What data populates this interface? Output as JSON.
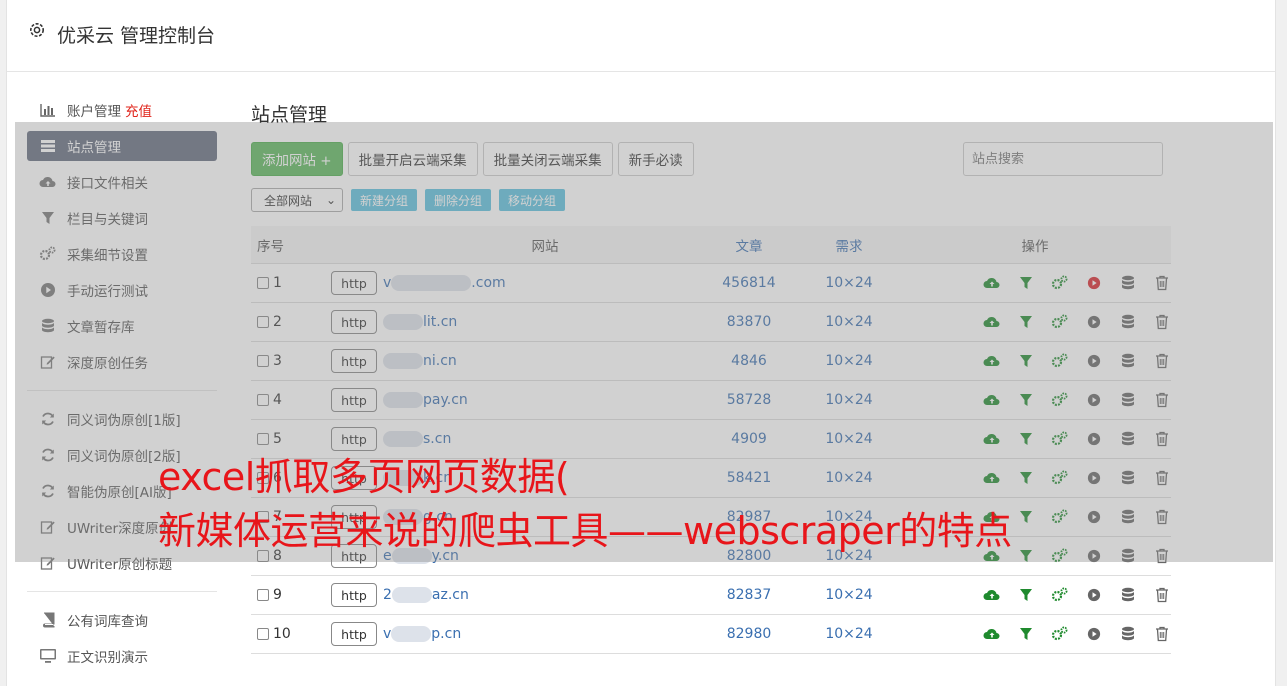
{
  "header": {
    "title": "优采云 管理控制台"
  },
  "sidebar": {
    "items": [
      {
        "label": "账户管理",
        "badge": "充值",
        "icon": "bar-chart-icon"
      },
      {
        "label": "站点管理",
        "icon": "server-icon",
        "active": true
      },
      {
        "label": "接口文件相关",
        "icon": "cloud-upload-icon"
      },
      {
        "label": "栏目与关键词",
        "icon": "filter-icon"
      },
      {
        "label": "采集细节设置",
        "icon": "gears-icon"
      },
      {
        "label": "手动运行测试",
        "icon": "play-circle-icon"
      },
      {
        "label": "文章暂存库",
        "icon": "database-icon"
      },
      {
        "label": "深度原创任务",
        "icon": "edit-icon"
      }
    ],
    "items2": [
      {
        "label": "同义词伪原创[1版]",
        "icon": "refresh-icon"
      },
      {
        "label": "同义词伪原创[2版]",
        "icon": "refresh-icon"
      },
      {
        "label": "智能伪原创[AI版]",
        "icon": "refresh-icon"
      },
      {
        "label": "UWriter深度原创",
        "icon": "edit-icon"
      },
      {
        "label": "UWriter原创标题",
        "icon": "edit-icon"
      }
    ],
    "items3": [
      {
        "label": "公有词库查询",
        "icon": "book-icon"
      },
      {
        "label": "正文识别演示",
        "icon": "monitor-icon"
      }
    ]
  },
  "main": {
    "title": "站点管理",
    "toolbar": {
      "add": "添加网站 +",
      "batch_open": "批量开启云端采集",
      "batch_close": "批量关闭云端采集",
      "guide": "新手必读"
    },
    "search_placeholder": "站点搜索",
    "group_select": "全部网站",
    "group_buttons": {
      "new": "新建分组",
      "delete": "删除分组",
      "move": "移动分组"
    },
    "columns": {
      "no": "序号",
      "site": "网站",
      "articles": "文章",
      "demand": "需求",
      "ops": "操作"
    },
    "rows": [
      {
        "no": "1",
        "prefix": "v",
        "domain": ".com",
        "articles": "456814",
        "demand": "10×24",
        "running": true
      },
      {
        "no": "2",
        "prefix": "",
        "domain": "lit.cn",
        "articles": "83870",
        "demand": "10×24",
        "running": false
      },
      {
        "no": "3",
        "prefix": "",
        "domain": "ni.cn",
        "articles": "4846",
        "demand": "10×24",
        "running": false
      },
      {
        "no": "4",
        "prefix": "",
        "domain": "pay.cn",
        "articles": "58728",
        "demand": "10×24",
        "running": false
      },
      {
        "no": "5",
        "prefix": "",
        "domain": "s.cn",
        "articles": "4909",
        "demand": "10×24",
        "running": false
      },
      {
        "no": "6",
        "prefix": "",
        "domain": "k.cn",
        "articles": "58421",
        "demand": "10×24",
        "running": false
      },
      {
        "no": "7",
        "prefix": "",
        "domain": "g.cn",
        "articles": "82987",
        "demand": "10×24",
        "running": false
      },
      {
        "no": "8",
        "prefix": "e",
        "domain": "y.cn",
        "articles": "82800",
        "demand": "10×24",
        "running": false
      },
      {
        "no": "9",
        "prefix": "2",
        "domain": "az.cn",
        "articles": "82837",
        "demand": "10×24",
        "running": false
      },
      {
        "no": "10",
        "prefix": "v",
        "domain": "p.cn",
        "articles": "82980",
        "demand": "10×24",
        "running": false
      }
    ],
    "http_label": "http"
  },
  "watermark": {
    "line1": "excel抓取多页网页数据(",
    "line2": "新媒体运营来说的爬虫工具——webscraper的特点"
  },
  "colors": {
    "accent_green": "#5cb85c",
    "info_blue": "#5bc0de",
    "link_blue": "#3a6fb0",
    "watermark_red": "#e8151a",
    "sidebar_active": "#636b7e"
  }
}
